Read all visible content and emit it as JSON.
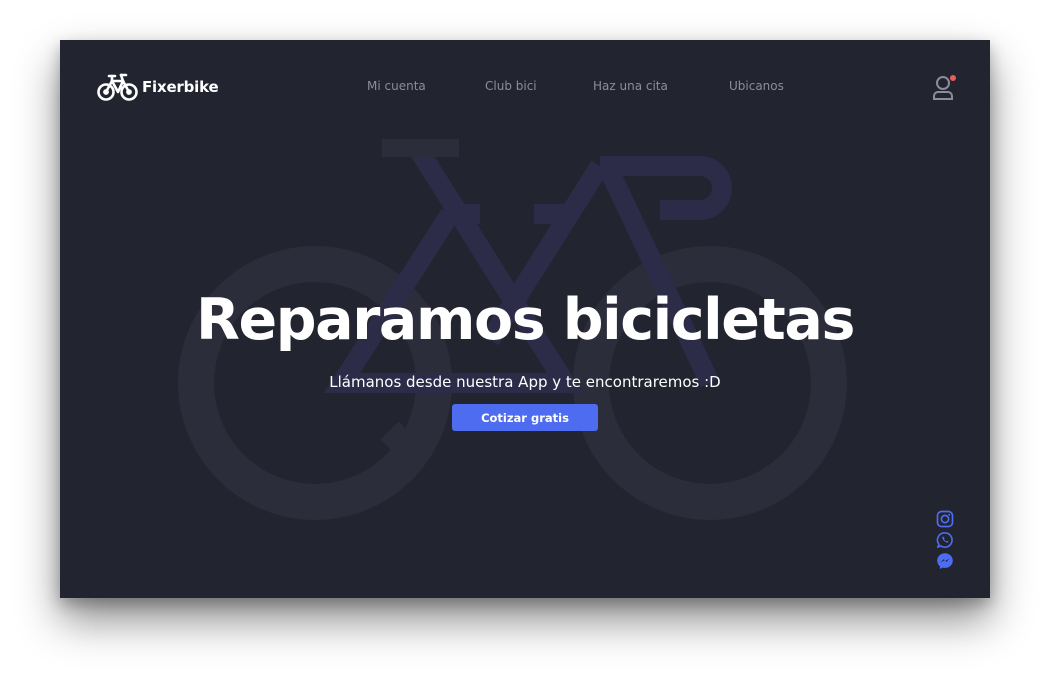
{
  "brand": {
    "name": "Fixerbike",
    "logo_icon": "bicycle-icon"
  },
  "nav": {
    "links": [
      {
        "label": "Mi cuenta"
      },
      {
        "label": "Club bici"
      },
      {
        "label": "Haz una cita"
      },
      {
        "label": "Ubicanos"
      }
    ],
    "user_icon": "user-icon",
    "notification_color": "#ef5b5b"
  },
  "hero": {
    "title": "Reparamos bicicletas",
    "subtitle": "Llámanos desde nuestra App y te encontraremos :D",
    "cta_label": "Cotizar gratis",
    "background_icon": "bicycle-illustration"
  },
  "social": [
    {
      "icon": "instagram-icon"
    },
    {
      "icon": "whatsapp-icon"
    },
    {
      "icon": "messenger-icon"
    }
  ],
  "colors": {
    "background": "#22242f",
    "accent": "#4e6cf0",
    "text": "#ffffff",
    "nav_text": "#8b8d9c",
    "illustration_gray": "#2c2e3b",
    "illustration_purple": "#2c2b48"
  }
}
